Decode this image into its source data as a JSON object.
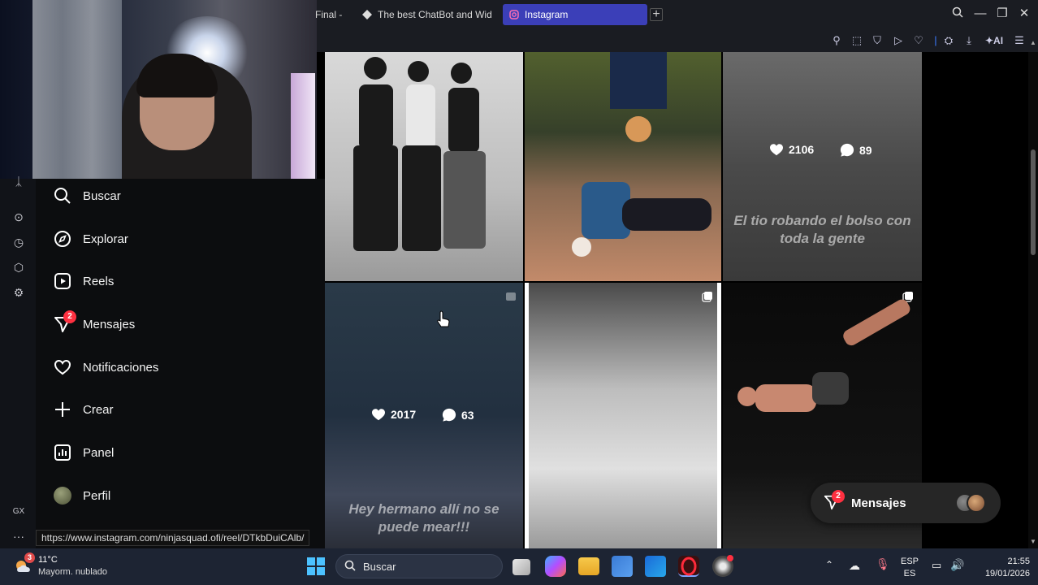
{
  "browser": {
    "tabs": [
      {
        "label": "Final -"
      },
      {
        "label": "The best ChatBot and Wid"
      },
      {
        "label": "Instagram"
      }
    ],
    "toolbar_ai_label": "AI"
  },
  "opera_rail": {
    "gx_label": "GX",
    "more_label": "···"
  },
  "instagram": {
    "nav": [
      {
        "label": "Buscar",
        "icon": "search-icon"
      },
      {
        "label": "Explorar",
        "icon": "compass-icon"
      },
      {
        "label": "Reels",
        "icon": "reels-icon"
      },
      {
        "label": "Mensajes",
        "icon": "messenger-icon",
        "badge": "2"
      },
      {
        "label": "Notificaciones",
        "icon": "heart-icon"
      },
      {
        "label": "Crear",
        "icon": "plus-icon"
      },
      {
        "label": "Panel",
        "icon": "chart-icon"
      },
      {
        "label": "Perfil",
        "icon": "avatar"
      }
    ],
    "posts": [
      {
        "likes": "",
        "comments": "",
        "caption": ""
      },
      {
        "likes": "",
        "comments": "",
        "caption": ""
      },
      {
        "likes": "2106",
        "comments": "89",
        "caption": "El tio robando el bolso con toda la gente"
      },
      {
        "likes": "2017",
        "comments": "63",
        "caption": "Hey hermano allí no se puede mear!!!"
      },
      {
        "likes": "",
        "comments": "",
        "caption": ""
      },
      {
        "likes": "",
        "comments": "",
        "caption": ""
      }
    ],
    "messages_pill": {
      "label": "Mensajes",
      "badge": "2"
    }
  },
  "status_url": "https://www.instagram.com/ninjasquad.ofi/reel/DTkbDuiCAlb/",
  "taskbar": {
    "weather_temp": "11°C",
    "weather_desc": "Mayorm. nublado",
    "weather_badge": "3",
    "search_placeholder": "Buscar",
    "lang_line1": "ESP",
    "lang_line2": "ES",
    "time": "21:55",
    "date": "19/01/2026"
  },
  "colors": {
    "accent_tab": "#3b3fb8",
    "badge": "#ff3040",
    "taskbar": "#1d2433"
  }
}
